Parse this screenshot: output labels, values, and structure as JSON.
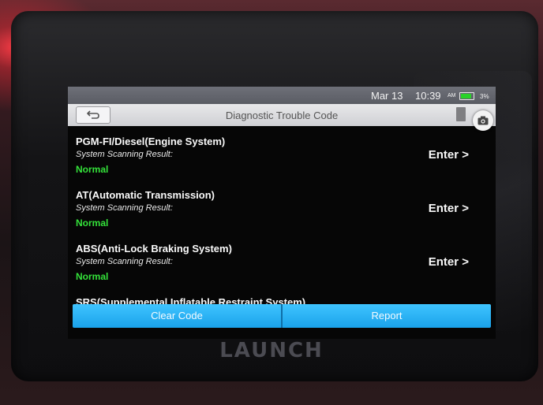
{
  "status_bar": {
    "date": "Mar 13",
    "time": "10:39",
    "ampm": "AM",
    "battery_percent": "3%",
    "battery_color": "#29d229"
  },
  "header": {
    "title": "Diagnostic Trouble Code",
    "back_icon": "back-arrow-icon",
    "camera_icon": "camera-icon"
  },
  "systems": [
    {
      "name": "PGM-FI/Diesel(Engine System)",
      "result_label": "System Scanning Result:",
      "status": "Normal",
      "action": "Enter >"
    },
    {
      "name": "AT(Automatic Transmission)",
      "result_label": "System Scanning Result:",
      "status": "Normal",
      "action": "Enter >"
    },
    {
      "name": "ABS(Anti-Lock Braking System)",
      "result_label": "System Scanning Result:",
      "status": "Normal",
      "action": "Enter >"
    },
    {
      "name": "SRS(Supplemental Inflatable Restraint System)"
    }
  ],
  "actions": {
    "clear_code": "Clear Code",
    "report": "Report",
    "accent": "#1aa2ea"
  },
  "device": {
    "brand": "LAUNCH"
  }
}
